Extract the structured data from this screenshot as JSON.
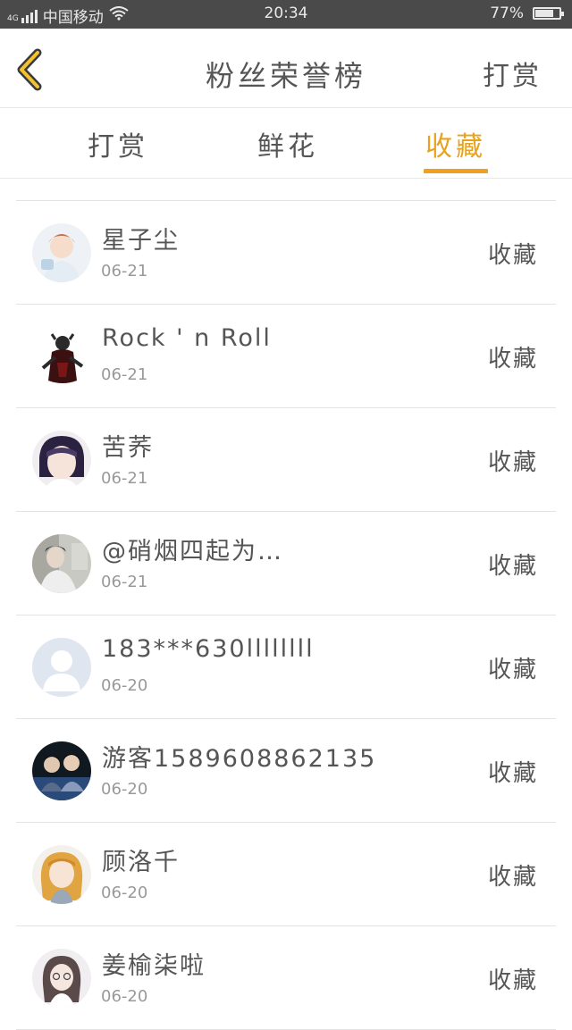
{
  "status_bar": {
    "signal_text": "4G",
    "carrier": "中国移动",
    "time": "20:34",
    "battery_text": "77%",
    "battery_level": 0.77
  },
  "nav": {
    "title": "粉丝荣誉榜",
    "action": "打赏",
    "back_icon": "chevron-left-icon",
    "accent_color": "#f0a01c"
  },
  "tabs": [
    {
      "label": "打赏",
      "active": false
    },
    {
      "label": "鲜花",
      "active": false
    },
    {
      "label": "收藏",
      "active": true
    }
  ],
  "rows": [
    {
      "name": "星子尘",
      "date": "06-21",
      "action": "收藏"
    },
    {
      "name": "Rock ' n Roll",
      "date": "06-21",
      "action": "收藏"
    },
    {
      "name": "苦荞",
      "date": "06-21",
      "action": "收藏"
    },
    {
      "name": "@硝烟四起为…",
      "date": "06-21",
      "action": "收藏"
    },
    {
      "name": "183***630llllllll",
      "date": "06-20",
      "action": "收藏"
    },
    {
      "name": "游客1589608862135",
      "date": "06-20",
      "action": "收藏"
    },
    {
      "name": "顾洛千",
      "date": "06-20",
      "action": "收藏"
    },
    {
      "name": "姜榆柒啦",
      "date": "06-20",
      "action": "收藏"
    }
  ]
}
